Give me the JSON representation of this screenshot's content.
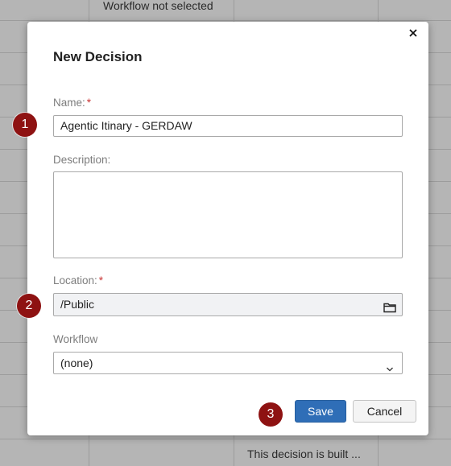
{
  "background": {
    "top_cell_text": "Workflow not selected",
    "bottom_cell_text": "This decision is built ..."
  },
  "dialog": {
    "title": "New Decision",
    "close_icon": "close-icon",
    "name": {
      "label": "Name:",
      "required_mark": "*",
      "value": "Agentic Itinary - GERDAW"
    },
    "description": {
      "label": "Description:",
      "value": ""
    },
    "location": {
      "label": "Location:",
      "required_mark": "*",
      "value": "/Public",
      "icon": "folder-icon"
    },
    "workflow": {
      "label": "Workflow",
      "selected": "(none)",
      "icon": "chevron-down-icon"
    },
    "buttons": {
      "save": "Save",
      "cancel": "Cancel"
    }
  },
  "step_markers": [
    "1",
    "2",
    "3"
  ],
  "colors": {
    "primary_button": "#2f6eb7",
    "marker": "#8e1212",
    "required": "#c93636"
  }
}
